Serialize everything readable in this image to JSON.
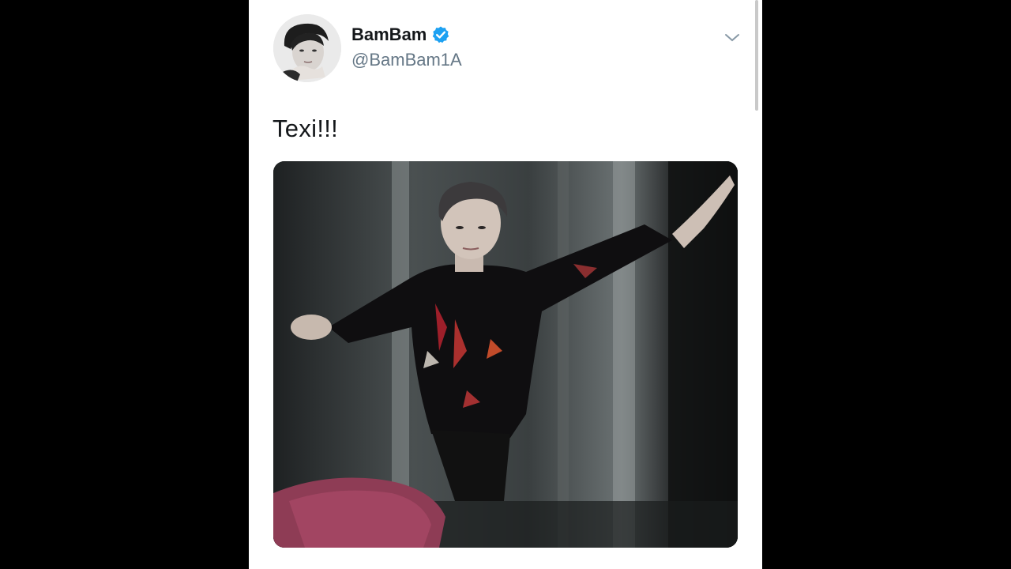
{
  "tweet": {
    "display_name": "BamBam",
    "handle": "@BamBam1A",
    "text": "Texi!!!",
    "verified": true,
    "avatar_icon": "profile-photo",
    "menu_icon": "chevron-down-icon",
    "media_icon": "performance-photo"
  },
  "colors": {
    "background": "#000000",
    "card": "#ffffff",
    "verified_blue": "#1da1f2",
    "name_text": "#14171a",
    "handle_text": "#657786"
  }
}
